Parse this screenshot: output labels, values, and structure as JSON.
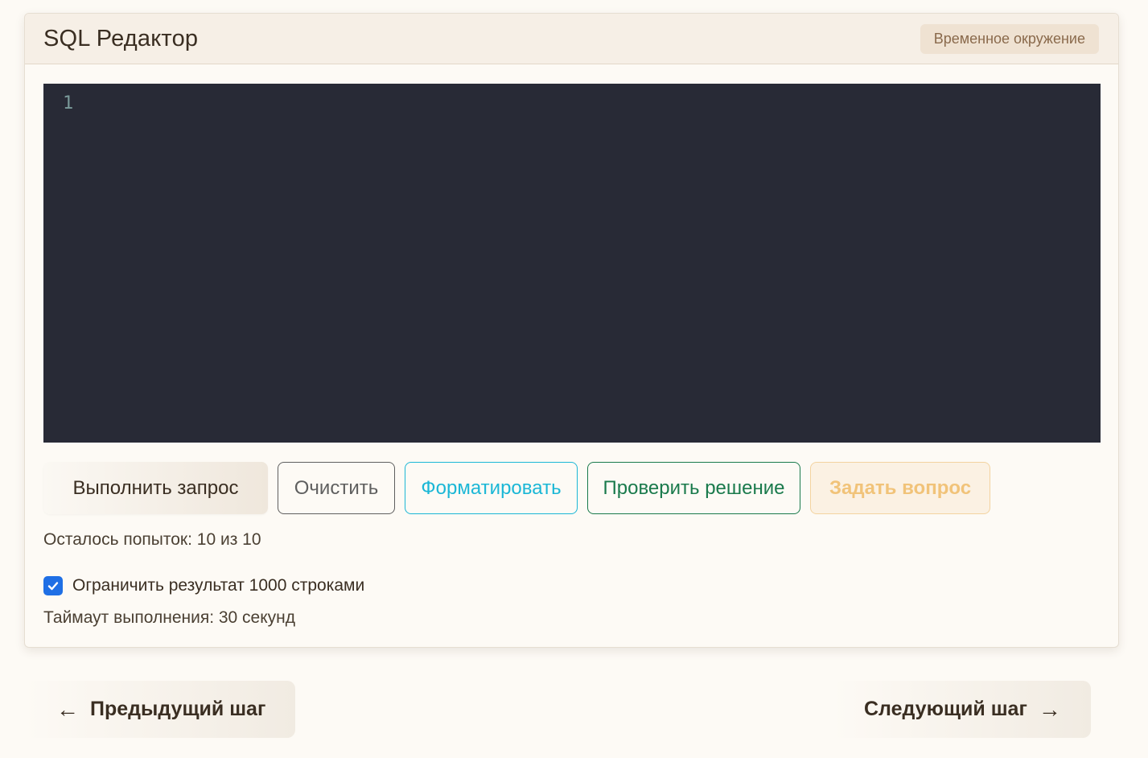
{
  "header": {
    "title": "SQL Редактор",
    "env_badge": "Временное окружение"
  },
  "editor": {
    "line_numbers": [
      "1"
    ],
    "code": ""
  },
  "toolbar": {
    "run_label": "Выполнить запрос",
    "clear_label": "Очистить",
    "format_label": "Форматировать",
    "check_label": "Проверить решение",
    "ask_label": "Задать вопрос"
  },
  "status": {
    "attempts": "Осталось попыток: 10 из 10",
    "limit_label": "Ограничить результат 1000 строками",
    "limit_checked": true,
    "timeout": "Таймаут выполнения: 30 секунд"
  },
  "navigation": {
    "prev_label": "Предыдущий шаг",
    "prev_arrow": "←",
    "next_label": "Следующий шаг",
    "next_arrow": "→"
  },
  "colors": {
    "editor_bg": "#282a36",
    "format_accent": "#1bb7d6",
    "check_accent": "#1a7a4c",
    "ask_accent": "#f1c379",
    "checkbox": "#1f6fe5"
  },
  "icons": {
    "checkbox_mark": "check-icon",
    "prev": "arrow-left-icon",
    "next": "arrow-right-icon"
  }
}
